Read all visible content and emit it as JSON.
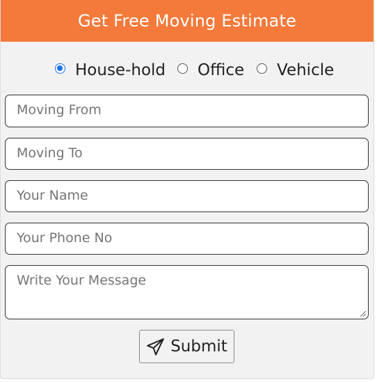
{
  "header": {
    "title": "Get Free Moving Estimate",
    "background_color": "#f47a3b"
  },
  "move_type": {
    "options": [
      {
        "label": "House-hold",
        "checked": true
      },
      {
        "label": "Office",
        "checked": false
      },
      {
        "label": "Vehicle",
        "checked": false
      }
    ],
    "selected": "House-hold",
    "accent_color": "#1a73e8"
  },
  "form": {
    "moving_from": {
      "value": "",
      "placeholder": "Moving From"
    },
    "moving_to": {
      "value": "",
      "placeholder": "Moving To"
    },
    "name": {
      "value": "",
      "placeholder": "Your Name"
    },
    "phone": {
      "value": "",
      "placeholder": "Your Phone No"
    },
    "message": {
      "value": "",
      "placeholder": "Write Your Message"
    }
  },
  "submit": {
    "label": "Submit",
    "icon": "paper-plane-icon"
  }
}
